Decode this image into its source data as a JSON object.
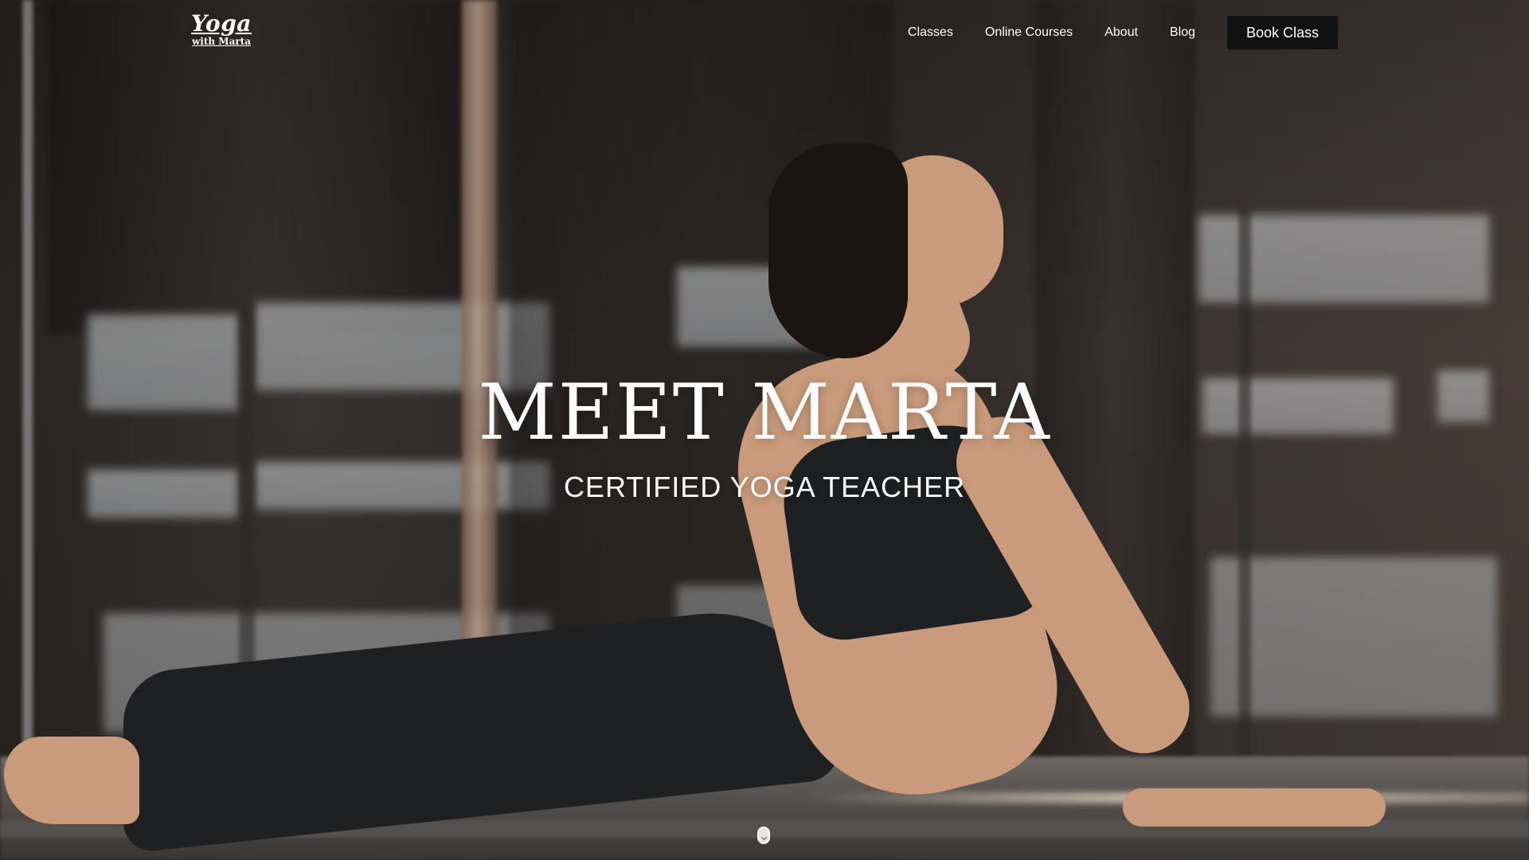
{
  "brand": {
    "logo_main": "Yoga",
    "logo_sub": "with Marta"
  },
  "nav": {
    "items": [
      {
        "label": "Classes"
      },
      {
        "label": "Online Courses"
      },
      {
        "label": "About"
      },
      {
        "label": "Blog"
      }
    ],
    "cta_label": "Book Class"
  },
  "hero": {
    "title": "MEET MARTA",
    "subtitle": "CERTIFIED YOGA TEACHER",
    "scroll_icon": "scroll-down-icon"
  },
  "colors": {
    "text": "#ffffff",
    "button_bg": "#111111",
    "button_text": "#ffffff"
  }
}
